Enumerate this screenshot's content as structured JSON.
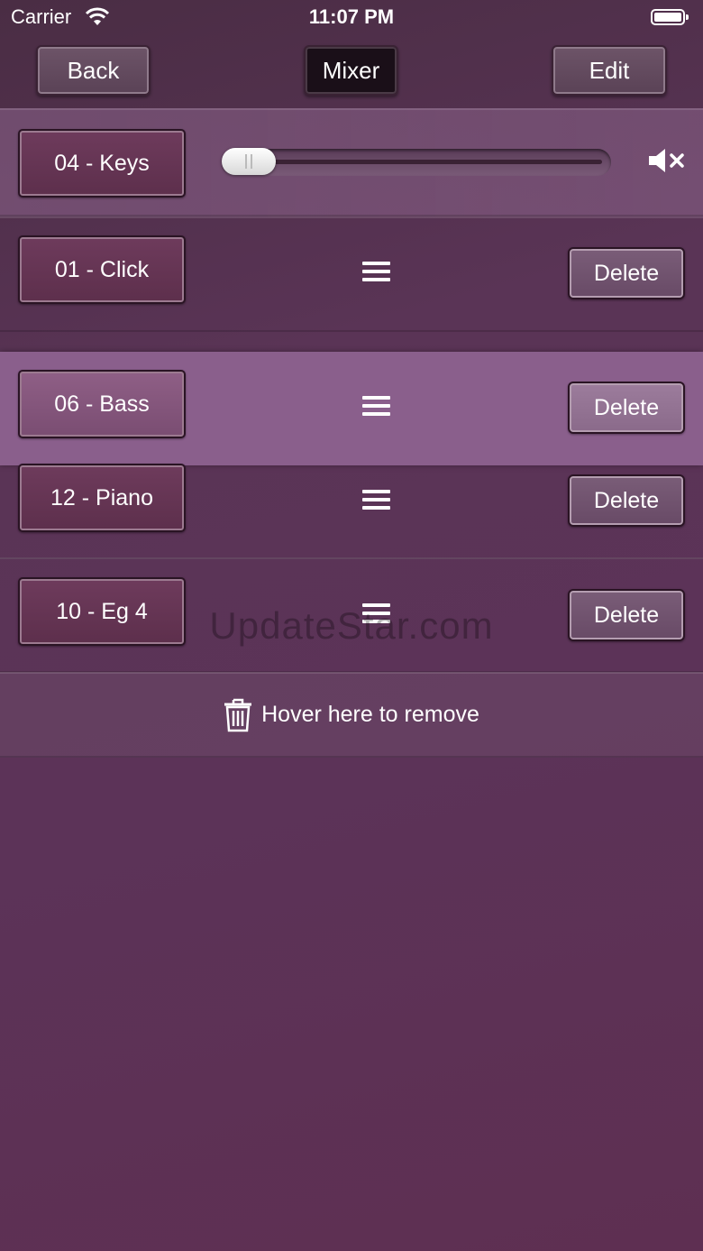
{
  "status_bar": {
    "carrier": "Carrier",
    "time": "11:07 PM"
  },
  "nav": {
    "back_label": "Back",
    "mixer_label": "Mixer",
    "edit_label": "Edit"
  },
  "mixer_row": {
    "track_label": "04 - Keys",
    "volume_level": 0.0,
    "mute_icon": "speaker-muted-icon"
  },
  "tracks": [
    {
      "label": "01 - Click",
      "delete_label": "Delete"
    },
    {
      "label": "06 - Bass",
      "delete_label": "Delete"
    },
    {
      "label": "12 - Piano",
      "delete_label": "Delete"
    },
    {
      "label": "10 - Eg 4",
      "delete_label": "Delete"
    }
  ],
  "remove_zone": {
    "label": "Hover here to remove",
    "icon": "trash-icon"
  },
  "watermark": "UpdateStar.com",
  "colors": {
    "highlight_row": "#8a5f8c",
    "button_face": "#6e3b5c"
  }
}
